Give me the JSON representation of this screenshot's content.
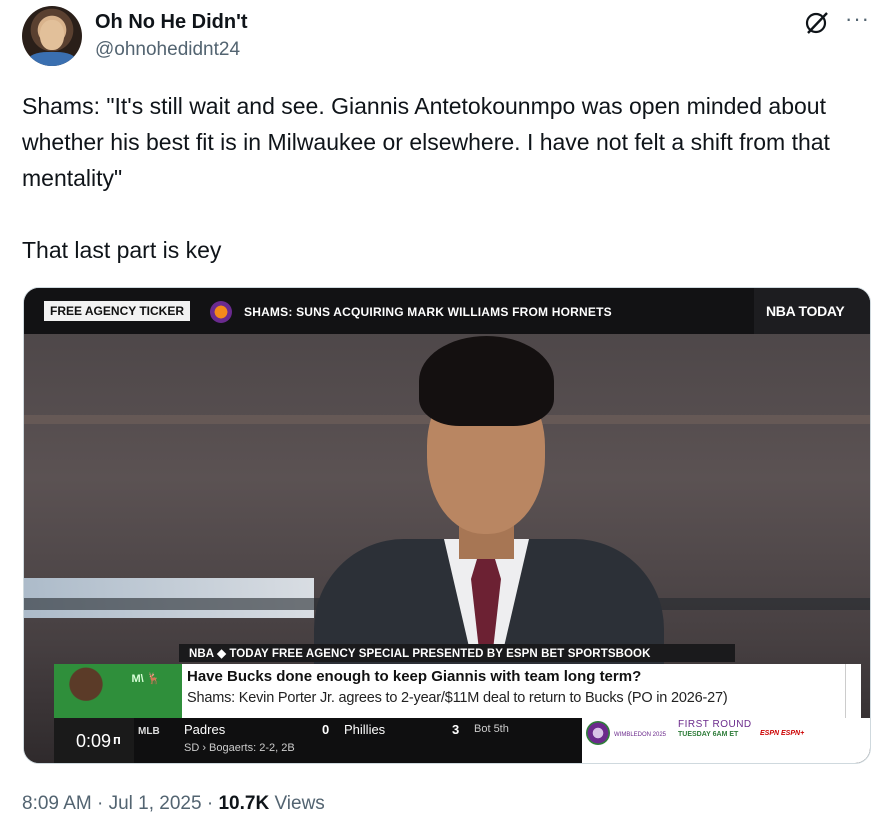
{
  "tweet": {
    "author_name": "Oh No He Didn't",
    "author_handle": "@ohnohedidnt24",
    "text": "Shams: \"It's still wait and see. Giannis Antetokounmpo was open minded about whether his best fit is in Milwaukee or elsewhere. I have not felt a shift from that mentality\"\n\nThat last part is key",
    "time": "8:09 AM",
    "date": "Jul 1, 2025",
    "views_count": "10.7K",
    "views_label": "Views"
  },
  "icons": {
    "grok": "grok-icon",
    "more": "more-icon",
    "more_glyph": "···"
  },
  "video": {
    "ticker_label": "FREE AGENCY TICKER",
    "ticker_text": "SHAMS: SUNS ACQUIRING MARK WILLIAMS FROM HORNETS",
    "show_logo": "NBA TODAY",
    "lower_strip": "NBA ◆ TODAY FREE AGENCY SPECIAL PRESENTED BY ESPN BET SPORTSBOOK",
    "bucks_logo_text": "M\\ 🦌",
    "headline": "Have Bucks done enough to keep Giannis with team long term?",
    "subline": "Shams: Kevin Porter Jr. agrees to 2-year/$11M deal to return to Bucks (PO in 2026-27)",
    "elapsed": "0:09",
    "network_mark": "ᴨ",
    "score": {
      "league": "MLB",
      "team1": "Padres",
      "team1_score": "0",
      "team2": "Phillies",
      "team2_score": "3",
      "inning": "Bot 5th",
      "batter": "SD  ›  Bogaerts: 2-2, 2B"
    },
    "promo": {
      "event": "WIMBLEDON 2025",
      "round": "FIRST ROUND",
      "time": "TUESDAY 6AM ET",
      "network": "ESPN  ESPN+"
    }
  },
  "colors": {
    "text_primary": "#0f1419",
    "text_secondary": "#536471",
    "bucks_green": "#2f8f3b"
  }
}
